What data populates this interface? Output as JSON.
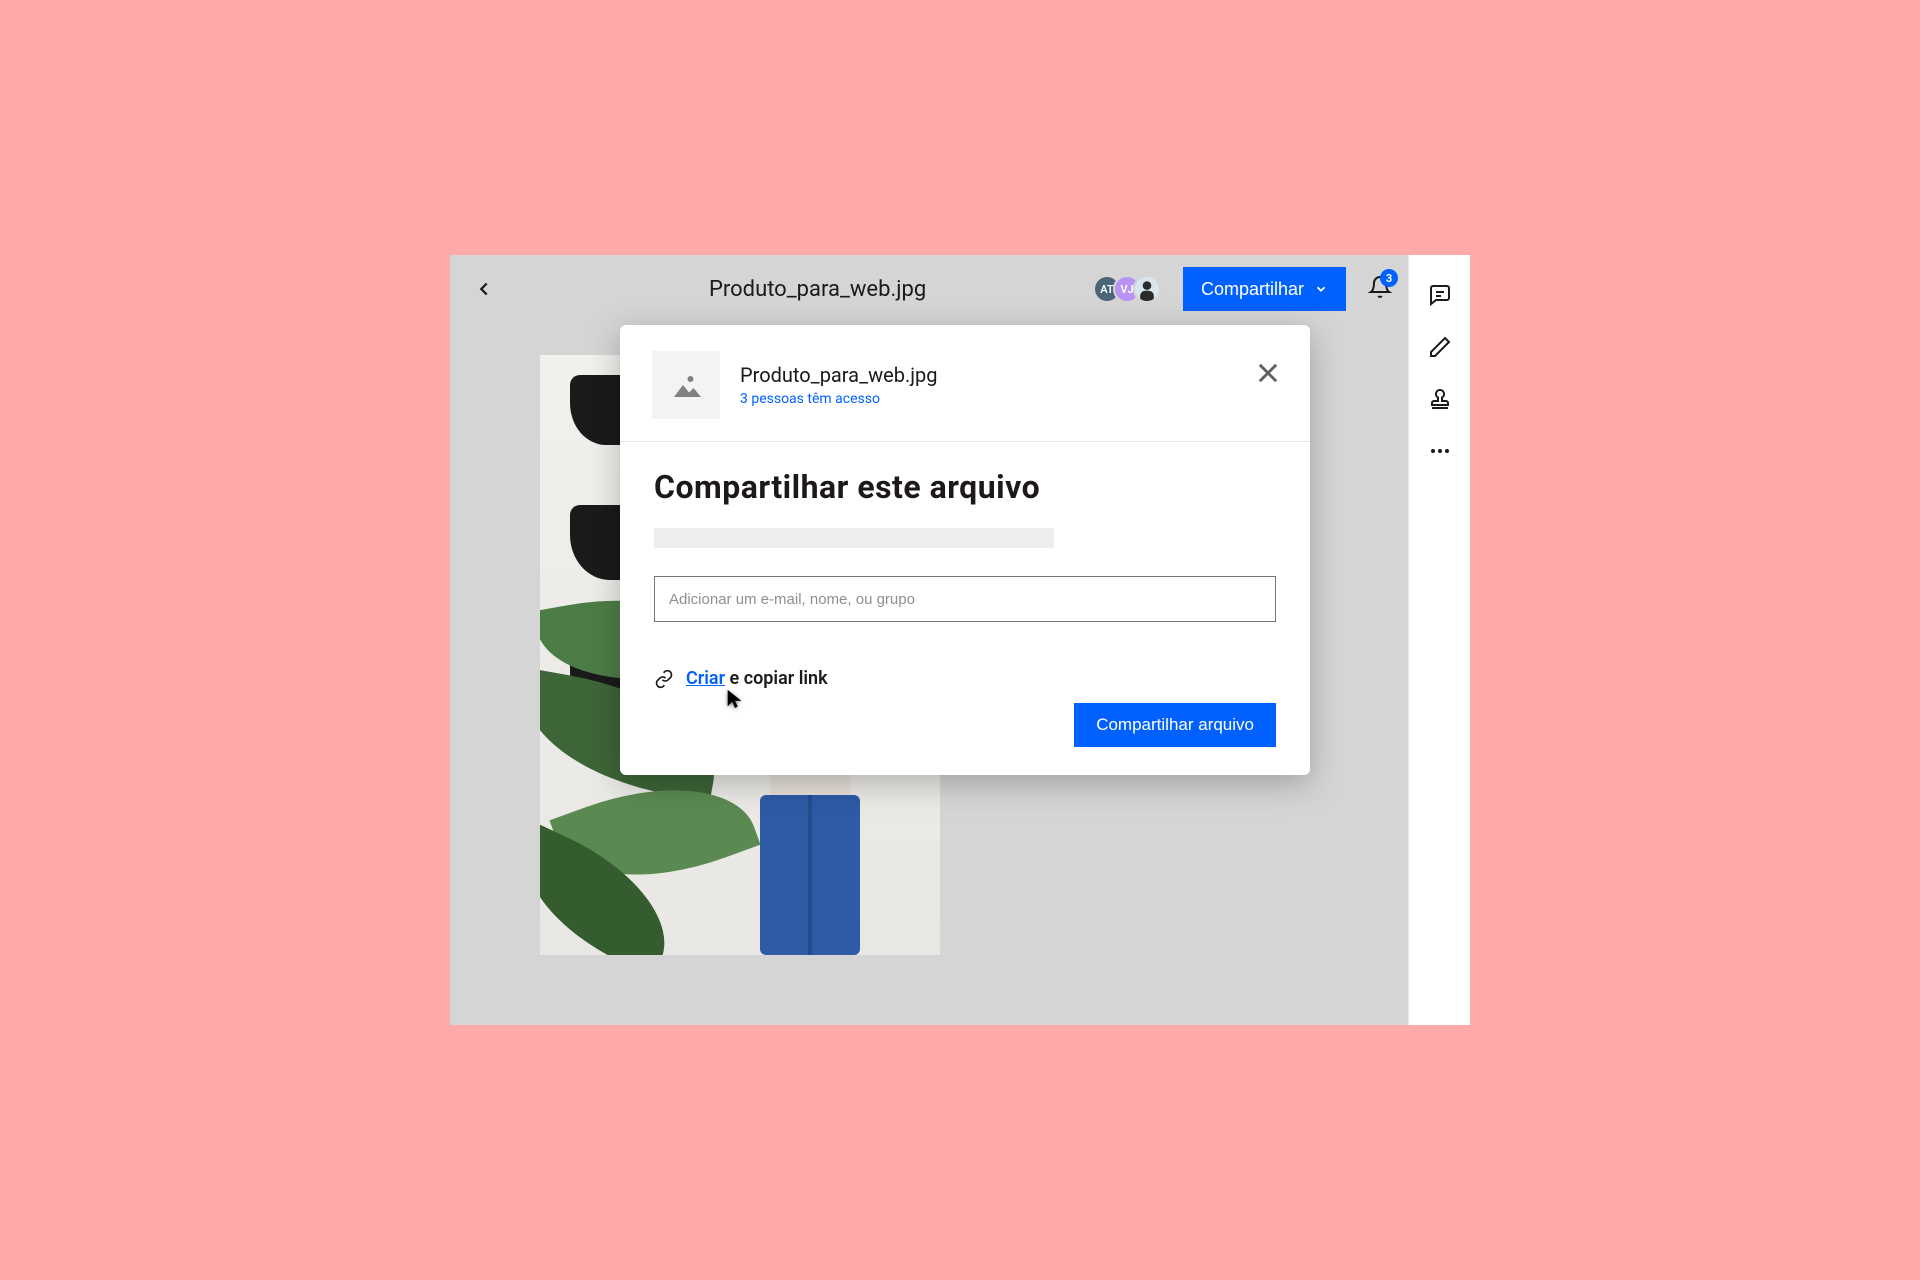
{
  "header": {
    "filename": "Produto_para_web.jpg",
    "avatars": [
      "AT",
      "VJ"
    ],
    "share_button_label": "Compartilhar",
    "notification_count": "3"
  },
  "modal": {
    "filename": "Produto_para_web.jpg",
    "access_text": "3 pessoas têm acesso",
    "title": "Compartilhar este arquivo",
    "email_placeholder": "Adicionar um e-mail, nome, ou grupo",
    "link_create_text": "Criar",
    "link_rest_text": " e copiar link",
    "share_file_button_label": "Compartilhar arquivo"
  },
  "colors": {
    "accent": "#0061fe"
  }
}
